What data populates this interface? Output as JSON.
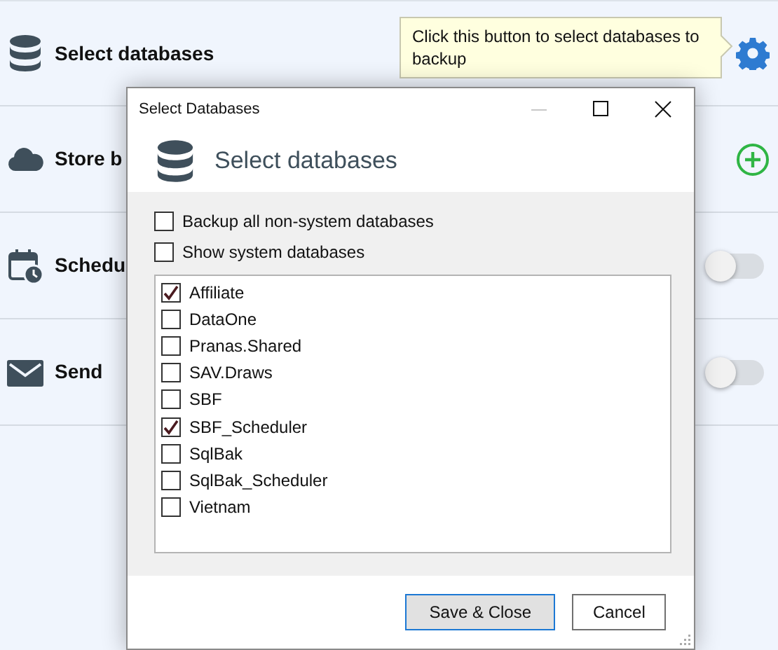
{
  "app_rows": [
    {
      "kind": "gear",
      "label": "Select databases"
    },
    {
      "kind": "add",
      "label": "Store b"
    },
    {
      "kind": "toggle",
      "label": "Schedu",
      "on": false
    },
    {
      "kind": "toggle",
      "label": "Send",
      "on": false
    }
  ],
  "tooltip": {
    "text": "Click this button to select databases to backup"
  },
  "dialog": {
    "title": "Select Databases",
    "heading": "Select databases",
    "options": [
      {
        "label": "Backup all non-system databases",
        "checked": false
      },
      {
        "label": "Show system databases",
        "checked": false
      }
    ],
    "databases": [
      {
        "label": "Affiliate",
        "checked": true
      },
      {
        "label": "DataOne",
        "checked": false
      },
      {
        "label": "Pranas.Shared",
        "checked": false
      },
      {
        "label": "SAV.Draws",
        "checked": false
      },
      {
        "label": "SBF",
        "checked": false
      },
      {
        "label": "SBF_Scheduler",
        "checked": true
      },
      {
        "label": "SqlBak",
        "checked": false
      },
      {
        "label": "SqlBak_Scheduler",
        "checked": false
      },
      {
        "label": "Vietnam",
        "checked": false
      }
    ],
    "buttons": [
      {
        "label": "Save & Close",
        "primary": true
      },
      {
        "label": "Cancel",
        "primary": false
      }
    ]
  }
}
